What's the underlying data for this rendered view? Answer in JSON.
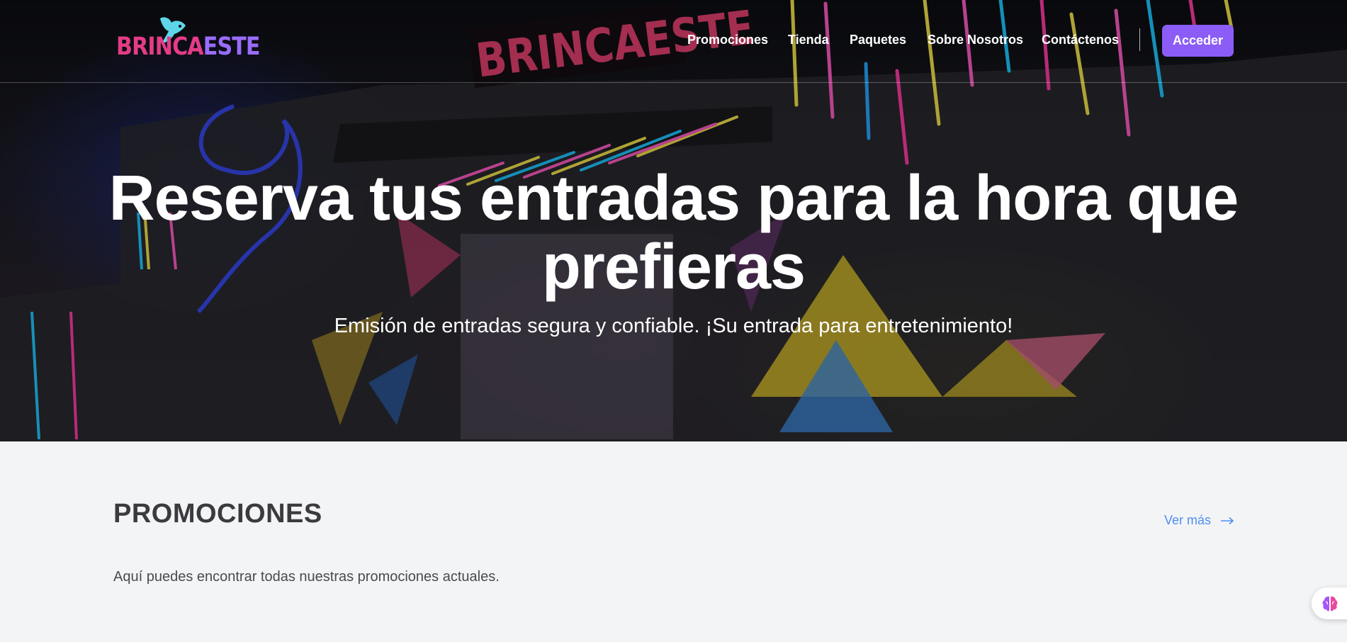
{
  "brand": {
    "logo_text_part1": "BRINCA",
    "logo_text_part2": "ESTE",
    "pink": "#e43c86",
    "purple": "#9a6cff",
    "accent": "#8b5cf6",
    "link_color": "#4f8ef2"
  },
  "nav": {
    "links": [
      {
        "label": "Promociones"
      },
      {
        "label": "Tienda"
      },
      {
        "label": "Paquetes"
      },
      {
        "label": "Sobre Nosotros"
      },
      {
        "label": "Contáctenos"
      }
    ],
    "login_label": "Acceder"
  },
  "hero": {
    "sign_text": "BRINCAESTE",
    "title": "Reserva tus entradas para la hora que prefieras",
    "subtitle": "Emisión de entradas segura y confiable. ¡Su entrada para entretenimiento!"
  },
  "promotions": {
    "title": "PROMOCIONES",
    "more_label": "Ver más",
    "more_icon": "arrow-right-icon",
    "description": "Aquí puedes encontrar todas nuestras promociones actuales."
  },
  "floating_widget": {
    "icon": "brain-icon"
  }
}
